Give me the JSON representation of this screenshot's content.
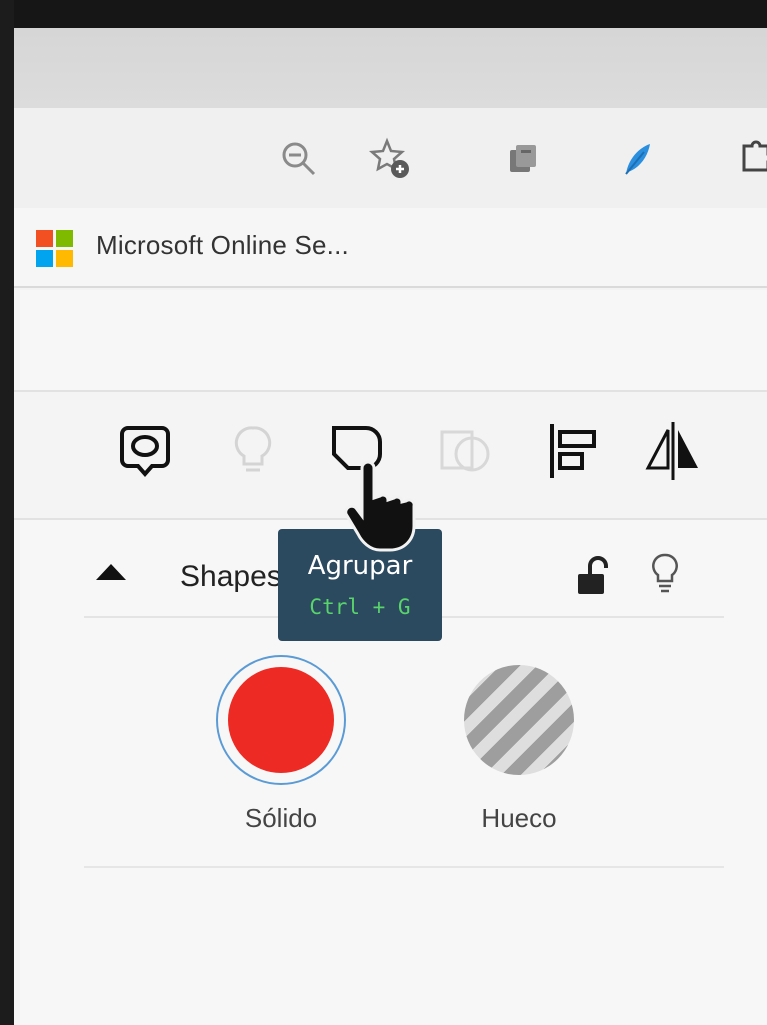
{
  "browser": {
    "favorites_bar": {
      "item_label": "Microsoft Online Se..."
    },
    "toolbar_icons": [
      "zoom-out-icon",
      "add-favorite-icon",
      "collections-icon",
      "feather-icon",
      "extensions-icon"
    ]
  },
  "app_toolbar": {
    "buttons": [
      "shape-icon",
      "bulb-icon",
      "group-icon",
      "ungroup-icon",
      "align-icon",
      "flip-icon"
    ]
  },
  "panel": {
    "title": "Shapes",
    "fill_options": [
      {
        "label": "Sólido",
        "color": "#ee2a24",
        "selected": true
      },
      {
        "label": "Hueco",
        "color": "#9e9e9e",
        "selected": false
      }
    ]
  },
  "tooltip": {
    "title": "Agrupar",
    "shortcut": "Ctrl + G"
  },
  "colors": {
    "tooltip_bg": "#2b4a60",
    "tooltip_shortcut": "#59d46b",
    "selection_ring": "#5b9bd5"
  }
}
